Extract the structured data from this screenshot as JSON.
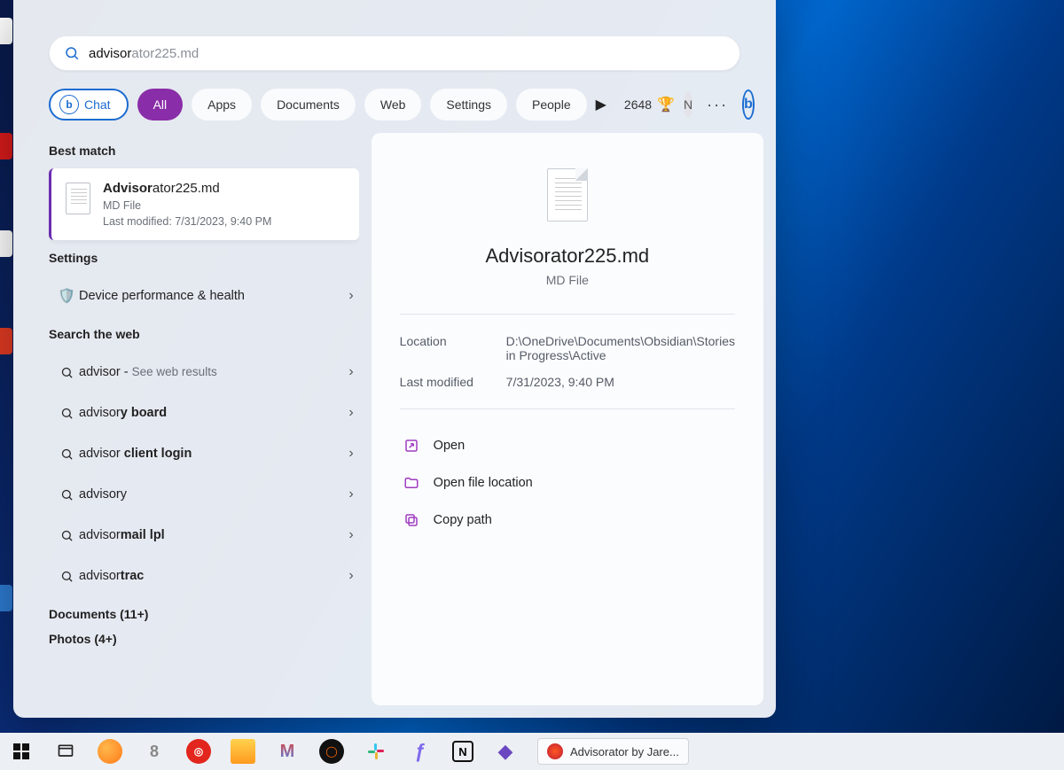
{
  "search": {
    "typed_prefix": "advisor",
    "typed_suffix": "ator225.md"
  },
  "filters": {
    "chat": "Chat",
    "all": "All",
    "apps": "Apps",
    "documents": "Documents",
    "web": "Web",
    "settings": "Settings",
    "people": "People",
    "points": "2648",
    "avatar_initial": "N"
  },
  "left": {
    "best_match_heading": "Best match",
    "best_match": {
      "title_bold": "Advisor",
      "title_rest": "ator225.md",
      "type": "MD File",
      "last_modified_label": "Last modified: 7/31/2023, 9:40 PM"
    },
    "settings_heading": "Settings",
    "settings_item": {
      "label": "Device performance & health"
    },
    "web_heading": "Search the web",
    "web_items": [
      {
        "pre": "advisor",
        "bold": "",
        "post": " - ",
        "dim": "See web results"
      },
      {
        "pre": "advisor",
        "bold": "y board",
        "post": "",
        "dim": ""
      },
      {
        "pre": "advisor ",
        "bold": "client login",
        "post": "",
        "dim": ""
      },
      {
        "pre": "advisory",
        "bold": "",
        "post": "",
        "dim": ""
      },
      {
        "pre": "advisor",
        "bold": "mail lpl",
        "post": "",
        "dim": ""
      },
      {
        "pre": "advisor",
        "bold": "trac",
        "post": "",
        "dim": ""
      }
    ],
    "documents_heading": "Documents (11+)",
    "photos_heading": "Photos (4+)"
  },
  "preview": {
    "filename": "Advisorator225.md",
    "filetype": "MD File",
    "location_key": "Location",
    "location_val": "D:\\OneDrive\\Documents\\Obsidian\\Stories in Progress\\Active",
    "modified_key": "Last modified",
    "modified_val": "7/31/2023, 9:40 PM",
    "actions": {
      "open": "Open",
      "open_location": "Open file location",
      "copy_path": "Copy path"
    }
  },
  "taskbar": {
    "running_app": "Advisorator by Jare..."
  }
}
